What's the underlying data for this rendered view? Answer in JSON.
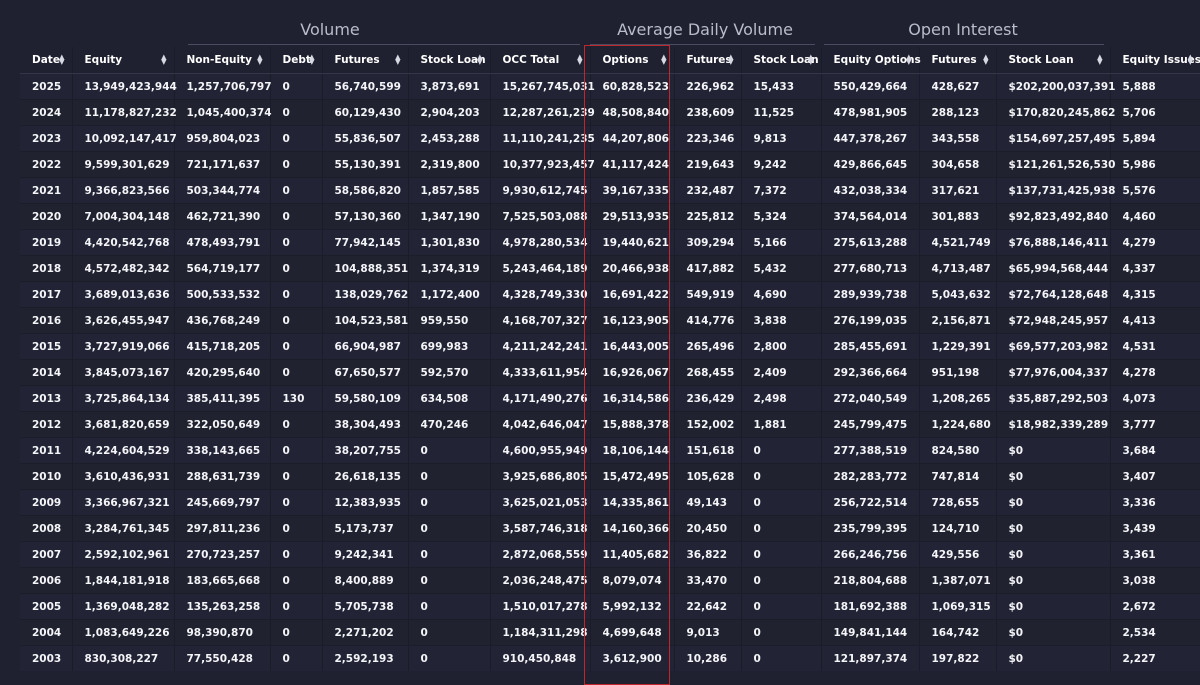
{
  "groups": {
    "volume": "Volume",
    "average_daily_volume": "Average Daily Volume",
    "open_interest": "Open Interest"
  },
  "columns": [
    "Date",
    "Equity",
    "Non-Equity",
    "Debt",
    "Futures",
    "Stock Loan",
    "OCC Total",
    "Options",
    "Futures",
    "Stock Loan",
    "Equity Options",
    "Futures",
    "Stock Loan",
    "Equity Issues"
  ],
  "highlight_color": "#c0272d",
  "sort_icon": "sort-updown-icon",
  "rows": [
    [
      "2025",
      "13,949,423,944",
      "1,257,706,797",
      "0",
      "56,740,599",
      "3,873,691",
      "15,267,745,031",
      "60,828,523",
      "226,962",
      "15,433",
      "550,429,664",
      "428,627",
      "$202,200,037,391",
      "5,888"
    ],
    [
      "2024",
      "11,178,827,232",
      "1,045,400,374",
      "0",
      "60,129,430",
      "2,904,203",
      "12,287,261,239",
      "48,508,840",
      "238,609",
      "11,525",
      "478,981,905",
      "288,123",
      "$170,820,245,862",
      "5,706"
    ],
    [
      "2023",
      "10,092,147,417",
      "959,804,023",
      "0",
      "55,836,507",
      "2,453,288",
      "11,110,241,235",
      "44,207,806",
      "223,346",
      "9,813",
      "447,378,267",
      "343,558",
      "$154,697,257,495",
      "5,894"
    ],
    [
      "2022",
      "9,599,301,629",
      "721,171,637",
      "0",
      "55,130,391",
      "2,319,800",
      "10,377,923,457",
      "41,117,424",
      "219,643",
      "9,242",
      "429,866,645",
      "304,658",
      "$121,261,526,530",
      "5,986"
    ],
    [
      "2021",
      "9,366,823,566",
      "503,344,774",
      "0",
      "58,586,820",
      "1,857,585",
      "9,930,612,745",
      "39,167,335",
      "232,487",
      "7,372",
      "432,038,334",
      "317,621",
      "$137,731,425,938",
      "5,576"
    ],
    [
      "2020",
      "7,004,304,148",
      "462,721,390",
      "0",
      "57,130,360",
      "1,347,190",
      "7,525,503,088",
      "29,513,935",
      "225,812",
      "5,324",
      "374,564,014",
      "301,883",
      "$92,823,492,840",
      "4,460"
    ],
    [
      "2019",
      "4,420,542,768",
      "478,493,791",
      "0",
      "77,942,145",
      "1,301,830",
      "4,978,280,534",
      "19,440,621",
      "309,294",
      "5,166",
      "275,613,288",
      "4,521,749",
      "$76,888,146,411",
      "4,279"
    ],
    [
      "2018",
      "4,572,482,342",
      "564,719,177",
      "0",
      "104,888,351",
      "1,374,319",
      "5,243,464,189",
      "20,466,938",
      "417,882",
      "5,432",
      "277,680,713",
      "4,713,487",
      "$65,994,568,444",
      "4,337"
    ],
    [
      "2017",
      "3,689,013,636",
      "500,533,532",
      "0",
      "138,029,762",
      "1,172,400",
      "4,328,749,330",
      "16,691,422",
      "549,919",
      "4,690",
      "289,939,738",
      "5,043,632",
      "$72,764,128,648",
      "4,315"
    ],
    [
      "2016",
      "3,626,455,947",
      "436,768,249",
      "0",
      "104,523,581",
      "959,550",
      "4,168,707,327",
      "16,123,905",
      "414,776",
      "3,838",
      "276,199,035",
      "2,156,871",
      "$72,948,245,957",
      "4,413"
    ],
    [
      "2015",
      "3,727,919,066",
      "415,718,205",
      "0",
      "66,904,987",
      "699,983",
      "4,211,242,241",
      "16,443,005",
      "265,496",
      "2,800",
      "285,455,691",
      "1,229,391",
      "$69,577,203,982",
      "4,531"
    ],
    [
      "2014",
      "3,845,073,167",
      "420,295,640",
      "0",
      "67,650,577",
      "592,570",
      "4,333,611,954",
      "16,926,067",
      "268,455",
      "2,409",
      "292,366,664",
      "951,198",
      "$77,976,004,337",
      "4,278"
    ],
    [
      "2013",
      "3,725,864,134",
      "385,411,395",
      "130",
      "59,580,109",
      "634,508",
      "4,171,490,276",
      "16,314,586",
      "236,429",
      "2,498",
      "272,040,549",
      "1,208,265",
      "$35,887,292,503",
      "4,073"
    ],
    [
      "2012",
      "3,681,820,659",
      "322,050,649",
      "0",
      "38,304,493",
      "470,246",
      "4,042,646,047",
      "15,888,378",
      "152,002",
      "1,881",
      "245,799,475",
      "1,224,680",
      "$18,982,339,289",
      "3,777"
    ],
    [
      "2011",
      "4,224,604,529",
      "338,143,665",
      "0",
      "38,207,755",
      "0",
      "4,600,955,949",
      "18,106,144",
      "151,618",
      "0",
      "277,388,519",
      "824,580",
      "$0",
      "3,684"
    ],
    [
      "2010",
      "3,610,436,931",
      "288,631,739",
      "0",
      "26,618,135",
      "0",
      "3,925,686,805",
      "15,472,495",
      "105,628",
      "0",
      "282,283,772",
      "747,814",
      "$0",
      "3,407"
    ],
    [
      "2009",
      "3,366,967,321",
      "245,669,797",
      "0",
      "12,383,935",
      "0",
      "3,625,021,053",
      "14,335,861",
      "49,143",
      "0",
      "256,722,514",
      "728,655",
      "$0",
      "3,336"
    ],
    [
      "2008",
      "3,284,761,345",
      "297,811,236",
      "0",
      "5,173,737",
      "0",
      "3,587,746,318",
      "14,160,366",
      "20,450",
      "0",
      "235,799,395",
      "124,710",
      "$0",
      "3,439"
    ],
    [
      "2007",
      "2,592,102,961",
      "270,723,257",
      "0",
      "9,242,341",
      "0",
      "2,872,068,559",
      "11,405,682",
      "36,822",
      "0",
      "266,246,756",
      "429,556",
      "$0",
      "3,361"
    ],
    [
      "2006",
      "1,844,181,918",
      "183,665,668",
      "0",
      "8,400,889",
      "0",
      "2,036,248,475",
      "8,079,074",
      "33,470",
      "0",
      "218,804,688",
      "1,387,071",
      "$0",
      "3,038"
    ],
    [
      "2005",
      "1,369,048,282",
      "135,263,258",
      "0",
      "5,705,738",
      "0",
      "1,510,017,278",
      "5,992,132",
      "22,642",
      "0",
      "181,692,388",
      "1,069,315",
      "$0",
      "2,672"
    ],
    [
      "2004",
      "1,083,649,226",
      "98,390,870",
      "0",
      "2,271,202",
      "0",
      "1,184,311,298",
      "4,699,648",
      "9,013",
      "0",
      "149,841,144",
      "164,742",
      "$0",
      "2,534"
    ],
    [
      "2003",
      "830,308,227",
      "77,550,428",
      "0",
      "2,592,193",
      "0",
      "910,450,848",
      "3,612,900",
      "10,286",
      "0",
      "121,897,374",
      "197,822",
      "$0",
      "2,227"
    ]
  ]
}
